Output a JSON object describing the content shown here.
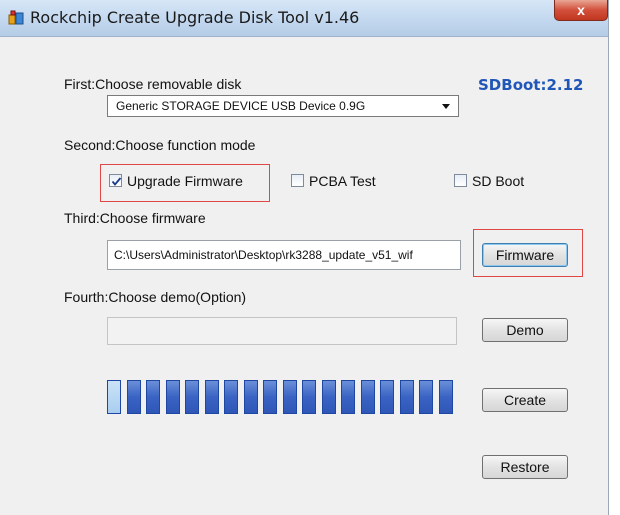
{
  "window": {
    "title": "Rockchip Create Upgrade Disk Tool v1.46",
    "close_label": "x"
  },
  "step1": {
    "label": "First:Choose removable disk",
    "disk_selected": "Generic STORAGE DEVICE USB Device  0.9G"
  },
  "sdboot_version": "SDBoot:2.12",
  "step2": {
    "label": "Second:Choose function mode",
    "options": [
      {
        "label": "Upgrade Firmware",
        "checked": true
      },
      {
        "label": "PCBA Test",
        "checked": false
      },
      {
        "label": "SD Boot",
        "checked": false
      }
    ]
  },
  "step3": {
    "label": "Third:Choose firmware",
    "path": "C:\\Users\\Administrator\\Desktop\\rk3288_update_v51_wif",
    "button": "Firmware"
  },
  "step4": {
    "label": "Fourth:Choose demo(Option)",
    "path": "",
    "button": "Demo"
  },
  "progress": {
    "segments_total": 18,
    "segments_active": 1
  },
  "buttons": {
    "create": "Create",
    "restore": "Restore"
  },
  "colors": {
    "highlight_box": "#e04848",
    "sdboot_text": "#2056b8",
    "progress_fill": "#3a63c4"
  }
}
